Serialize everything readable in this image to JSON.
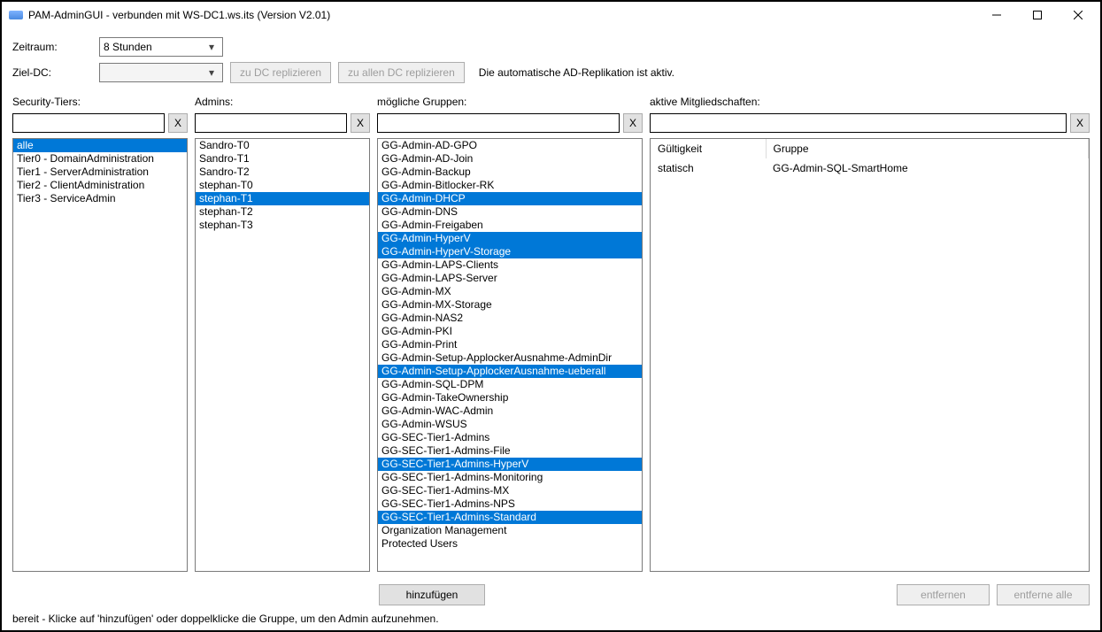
{
  "window": {
    "title": "PAM-AdminGUI - verbunden mit WS-DC1.ws.its (Version V2.01)"
  },
  "toolbar": {
    "zeitraum_label": "Zeitraum:",
    "zeitraum_value": "8 Stunden",
    "zieldc_label": "Ziel-DC:",
    "repl_dc": "zu DC replizieren",
    "repl_all": "zu allen DC replizieren",
    "info": "Die automatische AD-Replikation ist aktiv."
  },
  "headers": {
    "tiers": "Security-Tiers:",
    "admins": "Admins:",
    "groups": "mögliche Gruppen:",
    "memberships": "aktive Mitgliedschaften:"
  },
  "tiers": [
    {
      "label": "alle",
      "selected": true
    },
    {
      "label": "Tier0 - DomainAdministration",
      "selected": false
    },
    {
      "label": "Tier1 - ServerAdministration",
      "selected": false
    },
    {
      "label": "Tier2 - ClientAdministration",
      "selected": false
    },
    {
      "label": "Tier3 - ServiceAdmin",
      "selected": false
    }
  ],
  "admins": [
    {
      "label": "Sandro-T0",
      "selected": false
    },
    {
      "label": "Sandro-T1",
      "selected": false
    },
    {
      "label": "Sandro-T2",
      "selected": false
    },
    {
      "label": "stephan-T0",
      "selected": false
    },
    {
      "label": "stephan-T1",
      "selected": true
    },
    {
      "label": "stephan-T2",
      "selected": false
    },
    {
      "label": "stephan-T3",
      "selected": false
    }
  ],
  "groups": [
    {
      "label": "GG-Admin-AD-GPO",
      "selected": false
    },
    {
      "label": "GG-Admin-AD-Join",
      "selected": false
    },
    {
      "label": "GG-Admin-Backup",
      "selected": false
    },
    {
      "label": "GG-Admin-Bitlocker-RK",
      "selected": false
    },
    {
      "label": "GG-Admin-DHCP",
      "selected": true
    },
    {
      "label": "GG-Admin-DNS",
      "selected": false
    },
    {
      "label": "GG-Admin-Freigaben",
      "selected": false
    },
    {
      "label": "GG-Admin-HyperV",
      "selected": true
    },
    {
      "label": "GG-Admin-HyperV-Storage",
      "selected": true
    },
    {
      "label": "GG-Admin-LAPS-Clients",
      "selected": false
    },
    {
      "label": "GG-Admin-LAPS-Server",
      "selected": false
    },
    {
      "label": "GG-Admin-MX",
      "selected": false
    },
    {
      "label": "GG-Admin-MX-Storage",
      "selected": false
    },
    {
      "label": "GG-Admin-NAS2",
      "selected": false
    },
    {
      "label": "GG-Admin-PKI",
      "selected": false
    },
    {
      "label": "GG-Admin-Print",
      "selected": false
    },
    {
      "label": "GG-Admin-Setup-ApplockerAusnahme-AdminDir",
      "selected": false
    },
    {
      "label": "GG-Admin-Setup-ApplockerAusnahme-ueberall",
      "selected": true
    },
    {
      "label": "GG-Admin-SQL-DPM",
      "selected": false
    },
    {
      "label": "GG-Admin-TakeOwnership",
      "selected": false
    },
    {
      "label": "GG-Admin-WAC-Admin",
      "selected": false
    },
    {
      "label": "GG-Admin-WSUS",
      "selected": false
    },
    {
      "label": "GG-SEC-Tier1-Admins",
      "selected": false
    },
    {
      "label": "GG-SEC-Tier1-Admins-File",
      "selected": false
    },
    {
      "label": "GG-SEC-Tier1-Admins-HyperV",
      "selected": true
    },
    {
      "label": "GG-SEC-Tier1-Admins-Monitoring",
      "selected": false
    },
    {
      "label": "GG-SEC-Tier1-Admins-MX",
      "selected": false
    },
    {
      "label": "GG-SEC-Tier1-Admins-NPS",
      "selected": false
    },
    {
      "label": "GG-SEC-Tier1-Admins-Standard",
      "selected": true
    },
    {
      "label": "Organization Management",
      "selected": false
    },
    {
      "label": "Protected Users",
      "selected": false
    }
  ],
  "memberships": {
    "col_validity": "Gültigkeit",
    "col_group": "Gruppe",
    "rows": [
      {
        "validity": "statisch",
        "group": "GG-Admin-SQL-SmartHome"
      }
    ]
  },
  "buttons": {
    "add": "hinzufügen",
    "remove": "entfernen",
    "remove_all": "entferne alle",
    "clear_x": "X"
  },
  "status": "bereit - Klicke auf 'hinzufügen' oder doppelklicke die Gruppe, um den Admin aufzunehmen."
}
